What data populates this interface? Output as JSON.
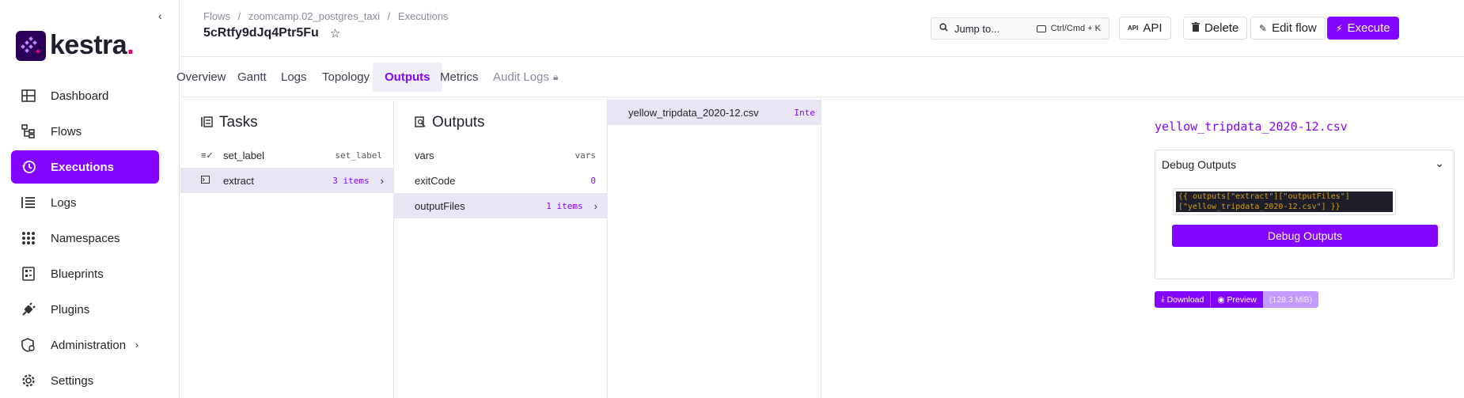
{
  "sidebar": {
    "collapse_icon": "chevron-left-icon",
    "logo_text": "kestra",
    "logo_dot": ".",
    "items": [
      {
        "label": "Dashboard",
        "icon": "dashboard-icon"
      },
      {
        "label": "Flows",
        "icon": "flows-icon"
      },
      {
        "label": "Executions",
        "icon": "history-icon",
        "active": true
      },
      {
        "label": "Logs",
        "icon": "logs-icon"
      },
      {
        "label": "Namespaces",
        "icon": "namespaces-icon"
      },
      {
        "label": "Blueprints",
        "icon": "blueprints-icon"
      },
      {
        "label": "Plugins",
        "icon": "plugin-icon"
      },
      {
        "label": "Administration",
        "icon": "admin-shield-icon",
        "has_submenu": true
      },
      {
        "label": "Settings",
        "icon": "gear-icon"
      }
    ]
  },
  "header": {
    "breadcrumbs": [
      "Flows",
      "/",
      "zoomcamp.02_postgres_taxi",
      "/",
      "Executions"
    ],
    "title": "5cRtfy9dJq4Ptr5Fu",
    "search_placeholder": "Jump to...",
    "shortcut": "Ctrl/Cmd + K",
    "buttons": {
      "api": "API",
      "delete": "Delete",
      "edit": "Edit flow",
      "execute": "Execute"
    }
  },
  "tabs": [
    "Overview",
    "Gantt",
    "Logs",
    "Topology",
    "Outputs",
    "Metrics",
    "Audit Logs"
  ],
  "active_tab": "Outputs",
  "tasks": {
    "heading": "Tasks",
    "rows": [
      {
        "label": "set_label",
        "value": "set_label"
      },
      {
        "label": "extract",
        "value": "3 items"
      }
    ]
  },
  "outputs": {
    "heading": "Outputs",
    "rows": [
      {
        "label": "vars",
        "value": "vars"
      },
      {
        "label": "exitCode",
        "value": "0"
      },
      {
        "label": "outputFiles",
        "value": "1 items"
      }
    ]
  },
  "files": {
    "name": "yellow_tripdata_2020-12.csv",
    "type": "Inte"
  },
  "panel": {
    "title": "yellow_tripdata_2020-12.csv",
    "debug_header": "Debug Outputs",
    "expression_line1": "{{ outputs[\"extract\"][\"outputFiles\"]",
    "expression_line2": "[\"yellow_tripdata_2020-12.csv\"] }}",
    "debug_button": "Debug Outputs",
    "download": "Download",
    "preview": "Preview",
    "size": "(128.3 MiB)"
  },
  "colors": {
    "accent": "#8405ff",
    "selected_row": "#e9e5f5"
  }
}
